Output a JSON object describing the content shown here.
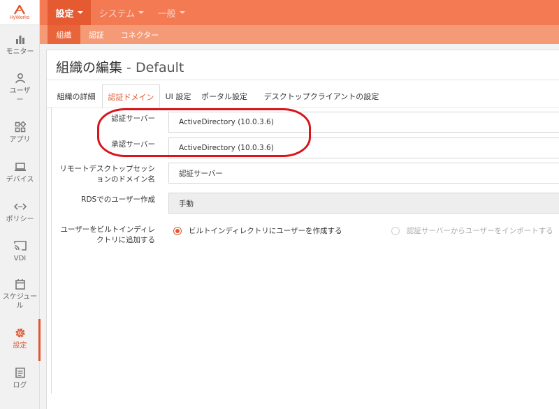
{
  "brand": {
    "name": "HyWorks",
    "accent": "#e0562f",
    "topbar": "#f37a52",
    "subbar": "#f59a76",
    "annotation": "#d8141c"
  },
  "sidebar": {
    "items": [
      {
        "label": "モニター",
        "icon": "bar-chart-icon",
        "active": false
      },
      {
        "label": "ユーザー",
        "icon": "user-icon",
        "active": false
      },
      {
        "label": "アプリ",
        "icon": "apps-grid-icon",
        "active": false
      },
      {
        "label": "デバイス",
        "icon": "laptop-icon",
        "active": false
      },
      {
        "label": "ポリシー",
        "icon": "code-arrows-icon",
        "active": false
      },
      {
        "label": "VDI",
        "icon": "cast-icon",
        "active": false
      },
      {
        "label": "スケジュール",
        "icon": "calendar-icon",
        "active": false
      },
      {
        "label": "設定",
        "icon": "gear-icon",
        "active": true
      },
      {
        "label": "ログ",
        "icon": "log-document-icon",
        "active": false
      }
    ]
  },
  "topnav": {
    "items": [
      {
        "label": "設定",
        "active": true
      },
      {
        "label": "システム",
        "active": false
      },
      {
        "label": "一般",
        "active": false
      }
    ]
  },
  "subnav": {
    "items": [
      {
        "label": "組織",
        "active": true
      },
      {
        "label": "認証",
        "active": false
      },
      {
        "label": "コネクター",
        "active": false
      }
    ]
  },
  "page": {
    "title": "組織の編集",
    "subtitle": " - Default"
  },
  "tabs": [
    {
      "label": "組織の詳細",
      "active": false
    },
    {
      "label": "認証ドメイン",
      "active": true
    },
    {
      "label": "UI 設定",
      "active": false
    },
    {
      "label": "ポータル設定",
      "active": false
    },
    {
      "label": "デスクトップクライアントの設定",
      "active": false
    }
  ],
  "form": {
    "auth_server": {
      "label": "認証サーバー",
      "value": "ActiveDirectory (10.0.3.6)"
    },
    "authz_server": {
      "label": "承認サーバー",
      "value": "ActiveDirectory (10.0.3.6)"
    },
    "rdp_domain": {
      "label": "リモートデスクトップセッションのドメイン名",
      "value": "認証サーバー"
    },
    "rds_user_creation": {
      "label": "RDSでのユーザー作成",
      "value": "手動"
    },
    "add_user": {
      "label": "ユーザーをビルトインディレクトリに追加する",
      "options": [
        {
          "label": "ビルトインディレクトリにユーザーを作成する",
          "checked": true,
          "disabled": false
        },
        {
          "label": "認証サーバーからユーザーをインポートする",
          "checked": false,
          "disabled": true
        }
      ]
    }
  }
}
